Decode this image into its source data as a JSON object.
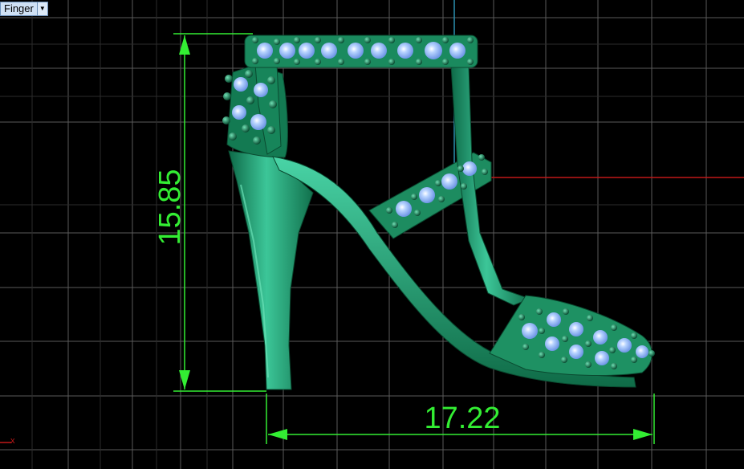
{
  "viewport": {
    "label": "Finger",
    "dropdown_icon": "triangle-down-icon",
    "axis_x_label": "x"
  },
  "dimensions": {
    "height_value": "15.85",
    "width_value": "17.22"
  },
  "colors": {
    "background": "#000000",
    "grid": "#5a5a5a",
    "dimension": "#33ee33",
    "model": "#1f9a6a",
    "gem": "#8fb8ff",
    "x_axis": "#c01818",
    "y_axis": "#2a8fb0"
  },
  "model": {
    "name": "high-heel-sandal-3d-model"
  }
}
